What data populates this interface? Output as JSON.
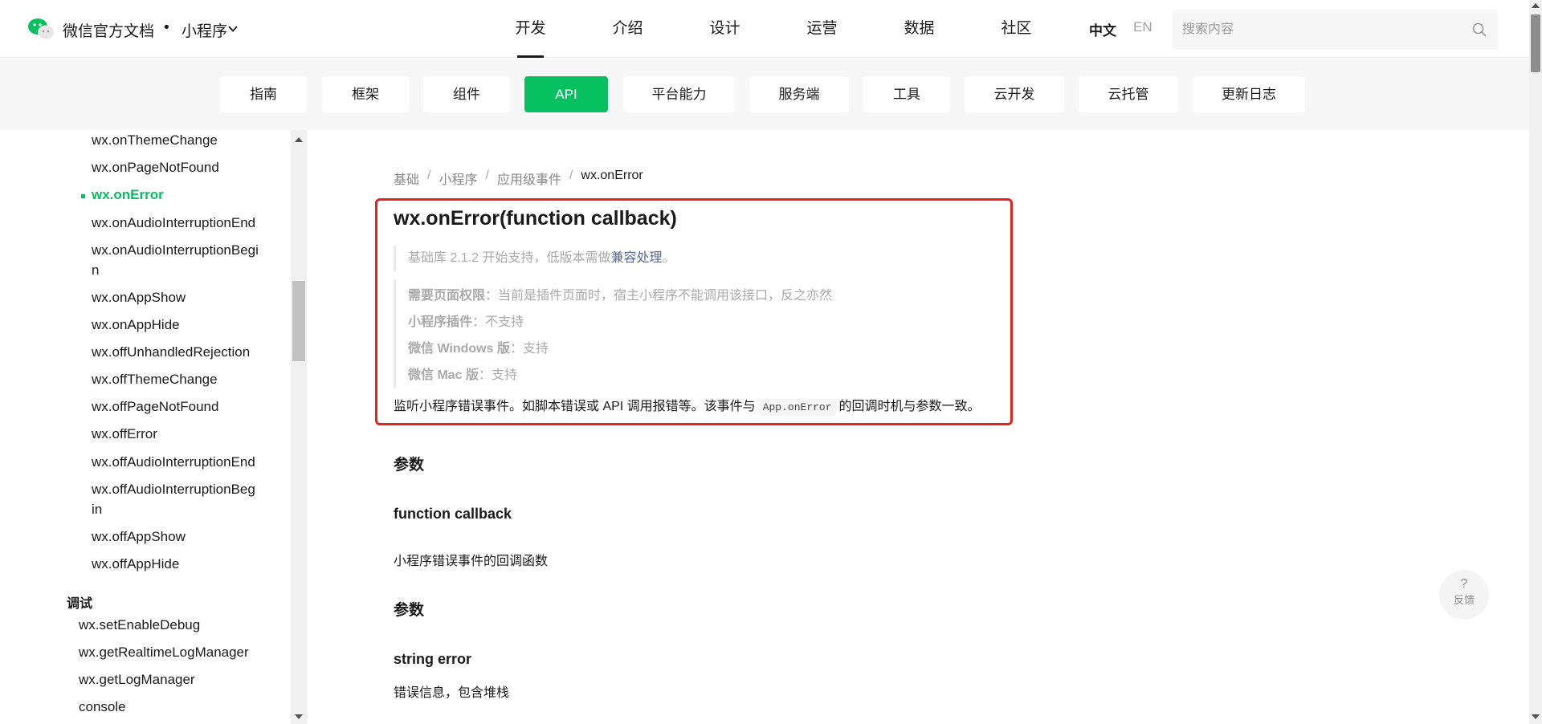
{
  "header": {
    "brand": "微信官方文档",
    "dot": "•",
    "product": "小程序",
    "nav": [
      "开发",
      "介绍",
      "设计",
      "运营",
      "数据",
      "社区"
    ],
    "lang_zh": "中文",
    "lang_en": "EN",
    "search_placeholder": "搜索内容"
  },
  "subnav": [
    "指南",
    "框架",
    "组件",
    "API",
    "平台能力",
    "服务端",
    "工具",
    "云开发",
    "云托管",
    "更新日志"
  ],
  "sidebar": {
    "items": [
      "wx.onThemeChange",
      "wx.onPageNotFound",
      "wx.onError",
      "wx.onAudioInterruptionBegi",
      "n",
      "wx.onAudioInterruptionEnd",
      "wx.onAppShow",
      "wx.onAppHide",
      "wx.offUnhandledRejection",
      "wx.offThemeChange",
      "wx.offPageNotFound",
      "wx.offError",
      "wx.offAudioInterruptionEnd",
      "wx.offAudioInterruptionBeg",
      "in",
      "wx.offAppShow",
      "wx.offAppHide"
    ],
    "section_debug": "调试",
    "debug_items": [
      "wx.setEnableDebug",
      "wx.getRealtimeLogManager",
      "wx.getLogManager",
      "console"
    ]
  },
  "breadcrumb": [
    "基础",
    "小程序",
    "应用级事件",
    "wx.onError"
  ],
  "content": {
    "title": "wx.onError(function callback)",
    "support_prefix": "基础库 2.1.2 开始支持，低版本需做",
    "support_link": "兼容处理",
    "support_suffix": "。",
    "perm_label": "需要页面权限",
    "perm_text": "：当前是插件页面时，宿主小程序不能调用该接口，反之亦然",
    "plugin_label": "小程序插件",
    "plugin_text": "：不支持",
    "win_label": "微信 Windows 版",
    "win_text": "：支持",
    "mac_label": "微信 Mac 版",
    "mac_text": "：支持",
    "desc_prefix": "监听小程序错误事件。如脚本错误或 API 调用报错等。该事件与",
    "desc_code": "App.onError",
    "desc_suffix": "的回调时机与参数一致。",
    "h_params": "参数",
    "h_callback": "function callback",
    "p_callback": "小程序错误事件的回调函数",
    "h_params2": "参数",
    "h_error": "string error",
    "p_error": "错误信息，包含堆栈"
  },
  "feedback": {
    "q": "?",
    "label": "反馈"
  },
  "colors": {
    "accent": "#07c160",
    "highlight_border": "#e8231f",
    "link": "#576b95"
  }
}
